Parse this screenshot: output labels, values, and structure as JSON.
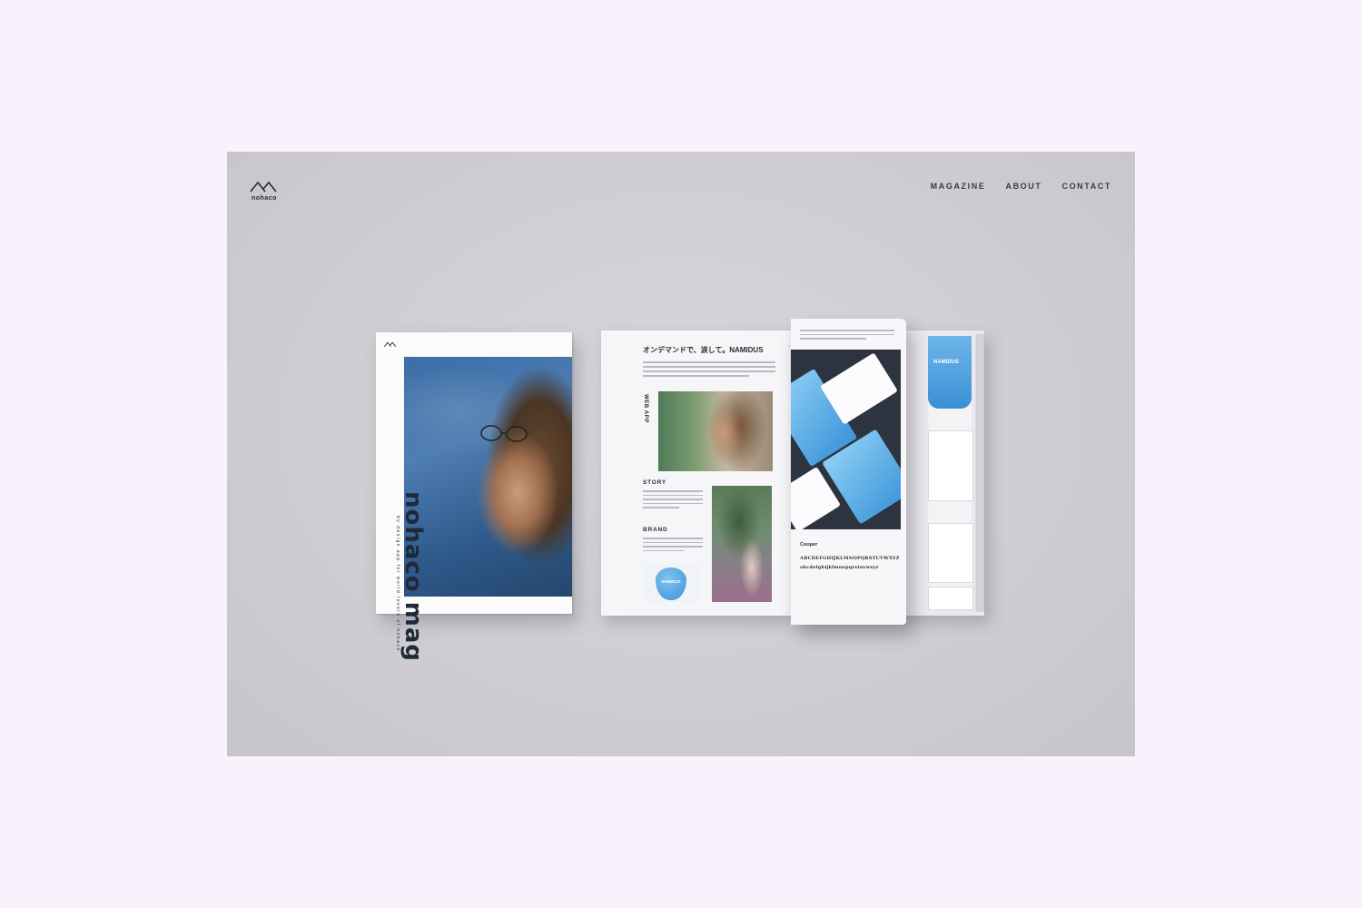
{
  "brand": {
    "name": "nohaco"
  },
  "nav": {
    "items": [
      "MAGAZINE",
      "ABOUT",
      "CONTACT"
    ]
  },
  "cover": {
    "title": "nohaco mag",
    "subtitle": "by design app for world lovers of nohaco"
  },
  "spread": {
    "headline": "オンデマンドで、涙して。NAMIDUS",
    "vertical_label": "WEB APP",
    "story_label": "STORY",
    "brand_label": "BRAND",
    "drop_label": "NAMIDUS",
    "tab_label": "NAMIDUS",
    "font_name": "Cooper",
    "alphabet_upper": "ABCDEFGHIJKLMNOPQRSTUVWXYZ",
    "alphabet_lower": "abcdefghijklmnopqrstuvwxyz"
  },
  "colors": {
    "page_background": "#f8f2fd",
    "frame_background": "#cfcdd2",
    "nav_text": "#3a3a40",
    "accent_blue": "#3e92d6"
  }
}
